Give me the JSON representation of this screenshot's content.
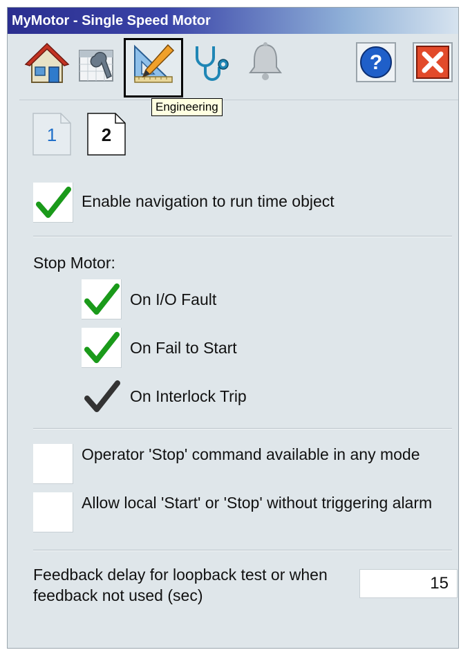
{
  "window": {
    "title": "MyMotor - Single Speed Motor"
  },
  "toolbar": {
    "tabs": [
      {
        "name": "home",
        "icon": "house-icon"
      },
      {
        "name": "maintenance",
        "icon": "calendar-wrench-icon"
      },
      {
        "name": "engineering",
        "icon": "ruler-pencil-icon",
        "selected": true
      },
      {
        "name": "diagnostics",
        "icon": "stethoscope-icon"
      },
      {
        "name": "alarms",
        "icon": "bell-icon"
      }
    ],
    "help_icon": "question-icon",
    "close_icon": "close-icon",
    "tooltip": "Engineering"
  },
  "pages": {
    "page1": "1",
    "page2": "2",
    "active": "2"
  },
  "options": {
    "enable_navigation": {
      "label": "Enable navigation to run time object",
      "checked": true
    },
    "stop_motor_heading": "Stop Motor:",
    "on_io_fault": {
      "label": "On I/O Fault",
      "checked": true
    },
    "on_fail_to_start": {
      "label": "On Fail to Start",
      "checked": true
    },
    "on_interlock_trip": {
      "label": "On Interlock Trip",
      "checked": true,
      "editable": false
    },
    "operator_stop": {
      "label": "Operator 'Stop' command available in any mode",
      "checked": false
    },
    "allow_local": {
      "label": "Allow local 'Start' or 'Stop' without triggering alarm",
      "checked": false
    }
  },
  "feedback": {
    "label": "Feedback delay for loopback test or when feedback not used (sec)",
    "value": "15"
  },
  "colors": {
    "check_green": "#1a9a1a",
    "check_dark": "#333333",
    "title_bar_start": "#2b2e8f",
    "panel_bg": "#dfe6ea"
  }
}
